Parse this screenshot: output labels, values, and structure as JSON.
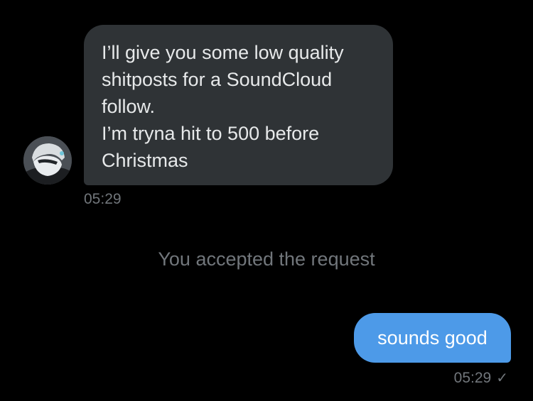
{
  "conversation": {
    "incoming": {
      "lines": [
        "I’ll give you some low quality",
        "shitposts for a SoundCloud",
        "follow.",
        "I’m tryna hit to 500 before",
        "Christmas"
      ],
      "time": "05:29",
      "avatar_icon": "user-avatar"
    },
    "system_message": "You accepted the request",
    "outgoing": {
      "text": "sounds good",
      "time": "05:29",
      "status_icon": "✓"
    }
  },
  "colors": {
    "background": "#000000",
    "incoming_bubble": "#2f3336",
    "outgoing_bubble": "#4d9ae8",
    "muted_text": "#71767b"
  }
}
